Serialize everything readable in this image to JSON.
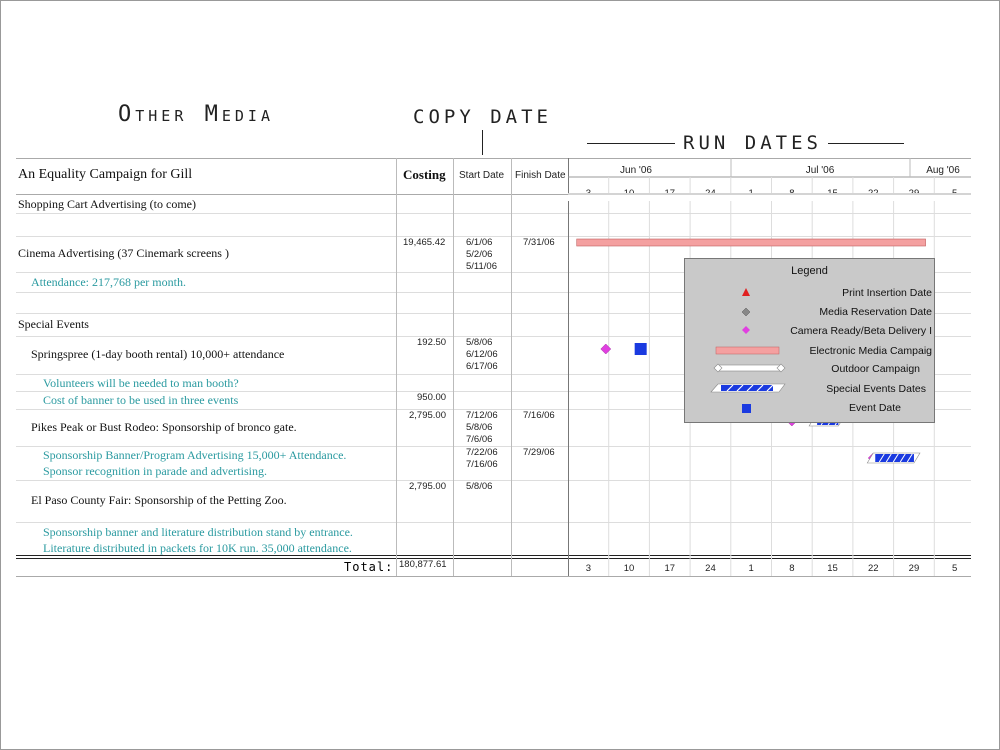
{
  "handwritten": {
    "other_media": "Other Media",
    "copy_date": "COPY DATE",
    "run_dates": "RUN DATES"
  },
  "header": {
    "project_title": "An Equality Campaign for Gill",
    "costing": "Costing",
    "start_date": "Start Date",
    "finish_date": "Finish Date",
    "months": [
      "Jun '06",
      "Jul '06",
      "Aug '06"
    ],
    "week_ticks": [
      "3",
      "10",
      "17",
      "24",
      "1",
      "8",
      "15",
      "22",
      "29",
      "5"
    ]
  },
  "rows": {
    "shopping_cart": "Shopping Cart Advertising (to come)",
    "cinema": "Cinema Advertising (37 Cinemark screens )",
    "cinema_cost": "19,465.42",
    "cinema_start": [
      "6/1/06",
      "5/2/06",
      "5/11/06"
    ],
    "cinema_finish": "7/31/06",
    "attendance": "Attendance: 217,768 per month.",
    "special_events": "Special Events",
    "springspree": "Springspree (1-day booth rental) 10,000+ attendance",
    "springspree_cost": "192.50",
    "springspree_start": [
      "5/8/06",
      "6/12/06",
      "6/17/06"
    ],
    "volunteers": "Volunteers will be needed to man booth?",
    "banner_cost_note": "Cost of banner to be used in three events",
    "banner_cost": "950.00",
    "pikes_peak": "Pikes Peak or Bust Rodeo: Sponsorship of bronco gate.",
    "pikes_cost": "2,795.00",
    "pikes_start": [
      "7/12/06",
      "5/8/06",
      "7/6/06"
    ],
    "pikes_finish": "7/16/06",
    "sponsorship_note": [
      "Sponsorship Banner/Program Advertising 15,000+ Attendance.",
      "Sponsor recognition in parade and advertising."
    ],
    "sponsorship_start": [
      "7/22/06",
      "7/16/06"
    ],
    "sponsorship_finish": "7/29/06",
    "el_paso": "El Paso County Fair: Sponsorship of the Petting Zoo.",
    "el_paso_cost": "2,795.00",
    "el_paso_start": "5/8/06",
    "el_paso_note": [
      "Sponsorship banner and literature distribution stand by entrance.",
      "Literature distributed in packets for 10K run. 35,000 attendance."
    ]
  },
  "total": {
    "label": "Total:",
    "value": "180,877.61"
  },
  "legend": {
    "title": "Legend",
    "items": [
      {
        "label": "Print Insertion Date",
        "icon": "triangle-icon"
      },
      {
        "label": "Media Reservation Date",
        "icon": "diamond-gray-icon"
      },
      {
        "label": "Camera Ready/Beta Delivery I",
        "icon": "diamond-magenta-icon"
      },
      {
        "label": "Electronic Media Campaig",
        "icon": "pink-bar-icon"
      },
      {
        "label": "Outdoor Campaign",
        "icon": "white-bar-icon"
      },
      {
        "label": "Special Events Dates",
        "icon": "striped-bar-icon"
      },
      {
        "label": "Event Date",
        "icon": "square-icon"
      }
    ]
  },
  "colors": {
    "note_text": "#2a9aa0",
    "pink_bar": "#f4a0a0",
    "magenta": "#e040e0",
    "blue": "#1a3ae0",
    "legend_bg": "#c9c9c9"
  },
  "timeline": {
    "weeks": [
      "2006-06-03",
      "2006-06-10",
      "2006-06-17",
      "2006-06-24",
      "2006-07-01",
      "2006-07-08",
      "2006-07-15",
      "2006-07-22",
      "2006-07-29",
      "2006-08-05"
    ],
    "cinema_bar": {
      "start": "2006-06-01",
      "end": "2006-07-31"
    },
    "springspree_diamond": "2006-06-06",
    "springspree_square": "2006-06-12",
    "pikes_diamond": "2006-07-08",
    "pikes_stripe": {
      "start": "2006-07-12",
      "end": "2006-07-16"
    },
    "sponsorship_diamond": "2006-07-22",
    "sponsorship_stripe": {
      "start": "2006-07-22",
      "end": "2006-07-29"
    }
  }
}
